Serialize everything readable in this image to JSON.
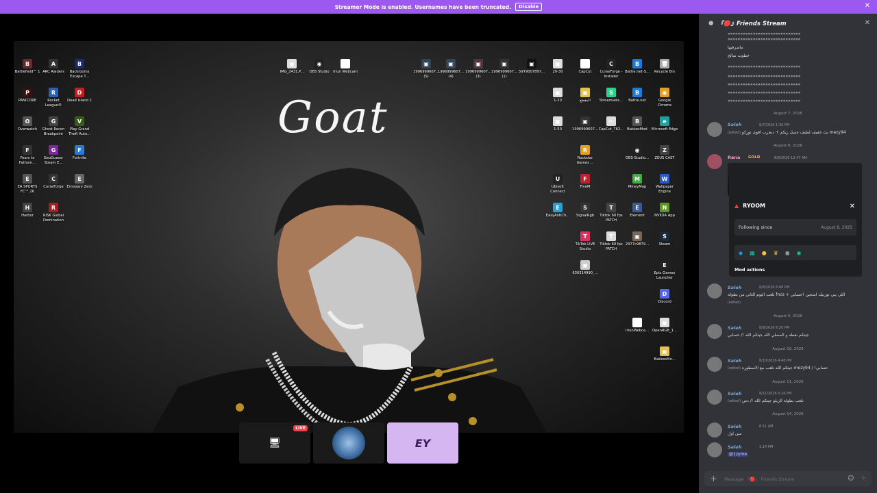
{
  "banner": {
    "text": "Streamer Mode is enabled. Usernames have been truncated.",
    "button": "Disable"
  },
  "desktop": {
    "wallpaper_text": "Goat",
    "icons": [
      {
        "label": "Battlefield™ 1",
        "color": "#6b2a2a",
        "glyph": "B"
      },
      {
        "label": "ARC Raiders",
        "color": "#333",
        "glyph": "A"
      },
      {
        "label": "Backrooms Escape T...",
        "color": "#1a2a6b",
        "glyph": "B"
      },
      {
        "label": "PANICORE",
        "color": "#3a1010",
        "glyph": "P"
      },
      {
        "label": "Rocket League®",
        "color": "#2c5fae",
        "glyph": "R"
      },
      {
        "label": "Dead Island 2",
        "color": "#c02020",
        "glyph": "D"
      },
      {
        "label": "Overwatch",
        "color": "#555",
        "glyph": "O"
      },
      {
        "label": "Ghost Recon Breakpoint",
        "color": "#444",
        "glyph": "G"
      },
      {
        "label": "Play Grand Theft Auto...",
        "color": "#3a5a1a",
        "glyph": "V"
      },
      {
        "label": "Fears to Fathom...",
        "color": "#333",
        "glyph": "F"
      },
      {
        "label": "GeoGuessr Steam E...",
        "color": "#7a2a9a",
        "glyph": "G"
      },
      {
        "label": "Fortnite",
        "color": "#2a7ad0",
        "glyph": "F"
      },
      {
        "label": "EA SPORTS FC™ 26",
        "color": "#555",
        "glyph": "E"
      },
      {
        "label": "CurseForge",
        "color": "#333",
        "glyph": "C"
      },
      {
        "label": "Emissary Zero",
        "color": "#666",
        "glyph": "E"
      },
      {
        "label": "Harbor",
        "color": "#444",
        "glyph": "H"
      },
      {
        "label": "RISK Global Domination",
        "color": "#a02020",
        "glyph": "R"
      },
      {
        "label": "IMG_2431.P...",
        "color": "#ddd",
        "glyph": "▣"
      },
      {
        "label": "OBS Studio",
        "color": "#222",
        "glyph": "◉"
      },
      {
        "label": "Iriun Webcam",
        "color": "#fff",
        "glyph": "◎"
      },
      {
        "label": "1996999607... (5)",
        "color": "#345",
        "glyph": "▣"
      },
      {
        "label": "1996999607... (4)",
        "color": "#345",
        "glyph": "▣"
      },
      {
        "label": "1996999607... (3)",
        "color": "#534",
        "glyph": "▣"
      },
      {
        "label": "1996999607... (1)",
        "color": "#333",
        "glyph": "▣"
      },
      {
        "label": "5979007897...",
        "color": "#111",
        "glyph": "▣"
      },
      {
        "label": "20-30",
        "color": "#ddd",
        "glyph": "▣"
      },
      {
        "label": "CapCut",
        "color": "#fff",
        "glyph": "✂"
      },
      {
        "label": "CurseForge - Installer",
        "color": "#222",
        "glyph": "C"
      },
      {
        "label": "Battle.net-S...",
        "color": "#1c7ad8",
        "glyph": "B"
      },
      {
        "label": "Recycle Bin",
        "color": "#aaa",
        "glyph": "🗑"
      },
      {
        "label": "1-20",
        "color": "#ddd",
        "glyph": "▣"
      },
      {
        "label": "المقطع",
        "color": "#e6c44b",
        "glyph": "▣"
      },
      {
        "label": "Streamlabs...",
        "color": "#30d090",
        "glyph": "S"
      },
      {
        "label": "Battle.net",
        "color": "#1c7ad8",
        "glyph": "B"
      },
      {
        "label": "Google Chrome",
        "color": "#e6a020",
        "glyph": "◉"
      },
      {
        "label": "1-50",
        "color": "#ddd",
        "glyph": "▣"
      },
      {
        "label": "1996999607...",
        "color": "#333",
        "glyph": "▣"
      },
      {
        "label": "CapCut_762...",
        "color": "#ddd",
        "glyph": "✂"
      },
      {
        "label": "BakkesMod",
        "color": "#555",
        "glyph": "B"
      },
      {
        "label": "Microsoft Edge",
        "color": "#1aa0a0",
        "glyph": "e"
      },
      {
        "label": "Rockstar Games ...",
        "color": "#e6a020",
        "glyph": "R"
      },
      {
        "label": "OBS-Studio...",
        "color": "#222",
        "glyph": "◉"
      },
      {
        "label": "ZEUS CAST",
        "color": "#444",
        "glyph": "Z"
      },
      {
        "label": "Ubisoft Connect",
        "color": "#222",
        "glyph": "U"
      },
      {
        "label": "FiveM",
        "color": "#c02030",
        "glyph": "F"
      },
      {
        "label": "MineyMap",
        "color": "#4a4",
        "glyph": "M"
      },
      {
        "label": "Wallpaper Engine",
        "color": "#2a5ad0",
        "glyph": "W"
      },
      {
        "label": "EasyAntiCh...",
        "color": "#2aa0d0",
        "glyph": "E"
      },
      {
        "label": "SignalRgb",
        "color": "#333",
        "glyph": "S"
      },
      {
        "label": "Tiktok 60 fps PATCH",
        "color": "#444",
        "glyph": "T"
      },
      {
        "label": "Element",
        "color": "#3a5a9a",
        "glyph": "E"
      },
      {
        "label": "NVIDIA App",
        "color": "#5a9a1a",
        "glyph": "N"
      },
      {
        "label": "TikTok LIVE Studio",
        "color": "#e03060",
        "glyph": "T"
      },
      {
        "label": "Tiktok 60 fps PATCH",
        "color": "#ddd",
        "glyph": "T"
      },
      {
        "label": "2977c9879...",
        "color": "#765",
        "glyph": "▣"
      },
      {
        "label": "Steam",
        "color": "#1b2838",
        "glyph": "S"
      },
      {
        "label": "636314990_...",
        "color": "#ccc",
        "glyph": "▣"
      },
      {
        "label": "Epic Games Launcher",
        "color": "#222",
        "glyph": "E"
      },
      {
        "label": "Discord",
        "color": "#5865f2",
        "glyph": "D"
      },
      {
        "label": "IriunWebca...",
        "color": "#fff",
        "glyph": "◎"
      },
      {
        "label": "OpenRGB_1...",
        "color": "#ddd",
        "glyph": "▣"
      },
      {
        "label": "BakkesMo...",
        "color": "#e6c44b",
        "glyph": "▣"
      }
    ]
  },
  "thumbnails": {
    "live_label": "LIVE",
    "third_text": "EY"
  },
  "panel": {
    "title": "『🔴』Friends Stream",
    "top_lines": [
      "ماضرفيها",
      "خطوت صالح"
    ],
    "messages": [
      {
        "date": "August 7, 2026",
        "user": "Saleh",
        "time": "8/7/2026 1:36 PM",
        "text": "بث خفيف لطيف جميل زيكم + ديجرب اقوى توركو mezy94",
        "edited": "(edited)"
      },
      {
        "date": "August 8, 2026",
        "user": "Rana",
        "badge": "GOLD",
        "time": "8/8/2026 12:47 AM"
      },
      {
        "date": "",
        "user": "Saleh",
        "time": "8/8/2026 6:00 PM",
        "text": "نلعب اليوم الثاني من بطولة fncs + اللي يبي تورنيك اسحين !حسابي",
        "edited": "(edited)"
      },
      {
        "date": "August 9, 2026",
        "user": "Saleh",
        "time": "8/9/2026 6:20 PM",
        "text": "جيتكم بعطه و المصلي الله جيتكم الله !/ حسابي"
      },
      {
        "date": "August 10, 2026",
        "user": "Saleh",
        "time": "8/10/2026 4:48 PM",
        "text": "جيتكم الله نلعب مع الاسطوره mezy94 / !حسابي",
        "edited": "(edited)"
      },
      {
        "date": "August 11, 2026",
        "user": "Saleh",
        "time": "8/11/2026 5:16 PM",
        "text": "نلعب بطولة الريلو جيتكم الله !/ دس",
        "edited": "(edited)"
      },
      {
        "date": "August 14, 2026",
        "user": "Saleh",
        "time": "6:11 AM",
        "text": "مين اول"
      },
      {
        "date": "",
        "user": "Saleh",
        "time": "1:14 PM",
        "text": "@1zyme"
      }
    ],
    "card": {
      "name": "RYOOM",
      "following_label": "Following since",
      "following_date": "August 8, 2025",
      "mod_actions": "Mod actions"
    },
    "composer": {
      "placeholder": "Message 『🔴』 Friends Stream"
    }
  }
}
